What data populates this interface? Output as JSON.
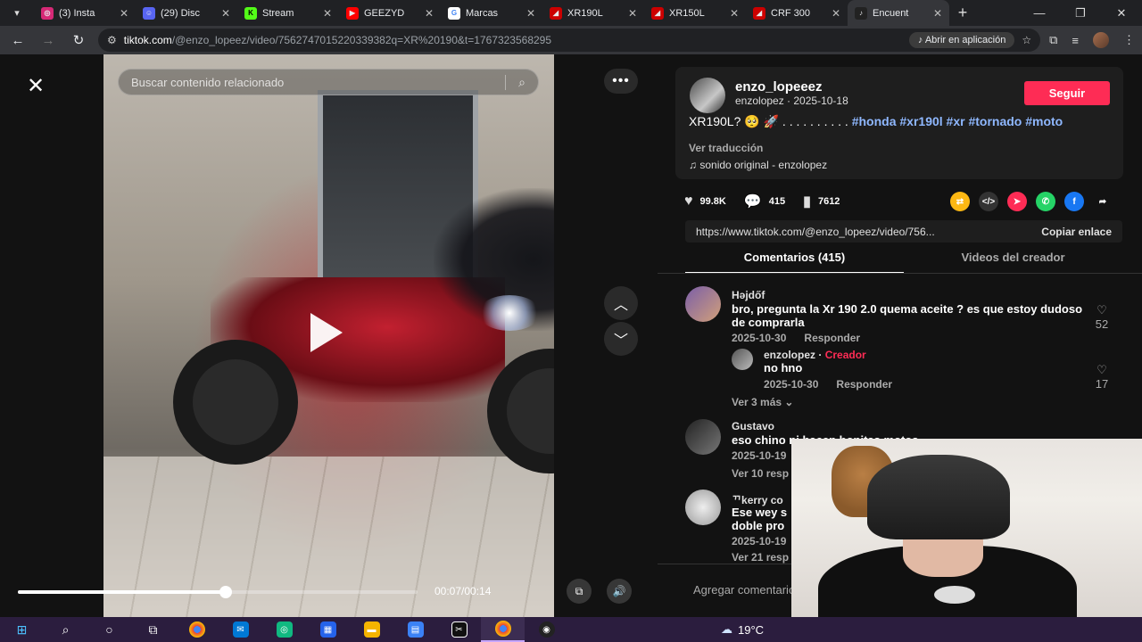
{
  "browser": {
    "tabs": [
      {
        "label": "(3) Insta",
        "icon": "instagram-icon",
        "color": "#d62976",
        "glyph": "◎"
      },
      {
        "label": "(29) Disc",
        "icon": "discord-icon",
        "color": "#5865f2",
        "glyph": "☺"
      },
      {
        "label": "Stream",
        "icon": "kick-icon",
        "color": "#53fc18",
        "glyph": "K"
      },
      {
        "label": "GEEZYD",
        "icon": "youtube-icon",
        "color": "#ff0000",
        "glyph": "▶"
      },
      {
        "label": "Marcas",
        "icon": "google-icon",
        "color": "#ffffff",
        "glyph": "G"
      },
      {
        "label": "XR190L",
        "icon": "honda-icon",
        "color": "#cc0000",
        "glyph": "◢"
      },
      {
        "label": "XR150L",
        "icon": "honda-icon",
        "color": "#cc0000",
        "glyph": "◢"
      },
      {
        "label": "CRF 300",
        "icon": "honda-icon",
        "color": "#cc0000",
        "glyph": "◢"
      },
      {
        "label": "Encuent",
        "icon": "tiktok-icon",
        "color": "#222222",
        "glyph": "♪",
        "active": true
      }
    ],
    "url_host": "tiktok.com",
    "url_path": "/@enzo_lopeez/video/7562747015220339382q=XR%20190&t=1767323568295",
    "open_app_label": "Abrir en aplicación"
  },
  "video": {
    "search_placeholder": "Buscar contenido relacionado",
    "time": "00:07/00:14",
    "progress": 0.52
  },
  "post": {
    "author_name": "enzo_lopeeez",
    "author_sub": "enzolopez · 2025-10-18",
    "follow_label": "Seguir",
    "desc_text": "XR190L? 🥺 🚀 . . . . . . . . . . ",
    "desc_tags": "#honda #xr190l #xr #tornado #moto",
    "translate_label": "Ver traducción",
    "sound_label": "sonido original - enzolopez",
    "likes": "99.8K",
    "comments": "415",
    "saves": "7612",
    "link": "https://www.tiktok.com/@enzo_lopeez/video/756...",
    "copy_label": "Copiar enlace",
    "tab_comments": "Comentarios (415)",
    "tab_videos": "Videos del creador"
  },
  "comments": [
    {
      "user": "Həjdőf",
      "text": "bro, pregunta la Xr 190 2.0 quema aceite ? es que estoy dudoso de comprarla",
      "date": "2025-10-30",
      "reply": "Responder",
      "likes": "52"
    },
    {
      "user": "enzolopez",
      "creator": "Creador",
      "text": "no hno",
      "date": "2025-10-30",
      "reply": "Responder",
      "likes": "17"
    },
    {
      "more": "Ver 3 más"
    },
    {
      "user": "Gustavo",
      "text": "eso chino ni hacen bonitas motos",
      "date": "2025-10-19",
      "more": "Ver 10 resp"
    },
    {
      "user": "ᄁkerry co",
      "text": "Ese wey s doble pro",
      "date": "2025-10-19",
      "more": "Ver 21 resp"
    }
  ],
  "add_comment_placeholder": "Agregar comentario",
  "taskbar": {
    "weather": "19°C"
  }
}
